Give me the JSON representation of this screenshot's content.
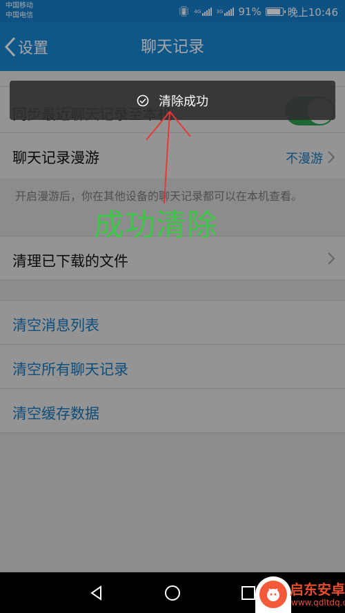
{
  "status_bar": {
    "carrier_1": "中国移动",
    "carrier_2": "中国电信",
    "network_1": "4G",
    "network_2": "3G",
    "battery": "91%",
    "battery_level": 0.91,
    "time": "晚上10:46"
  },
  "header": {
    "back_label": "设置",
    "title": "聊天记录"
  },
  "settings": {
    "sync_label": "同步最近聊天记录至本机",
    "sync_enabled": true,
    "roaming_label": "聊天记录漫游",
    "roaming_value": "不漫游",
    "roaming_hint": "开启漫游后，你在其他设备的聊天记录都可以在本机查看。",
    "files_label": "清理已下载的文件"
  },
  "actions": {
    "clear_message_list": "清空消息列表",
    "clear_all_records": "清空所有聊天记录",
    "clear_cache": "清空缓存数据"
  },
  "toast": {
    "text": "清除成功",
    "icon": "check-circle-icon"
  },
  "annotation": {
    "text": "成功清除"
  },
  "watermark": {
    "name": "启东安卓网",
    "url": "www.qdltdq.com"
  },
  "colors": {
    "accent": "#1a86d3",
    "toggle_on": "#2fb45c",
    "annotation_green": "#3fc64a",
    "arrow_red": "#e53935"
  }
}
